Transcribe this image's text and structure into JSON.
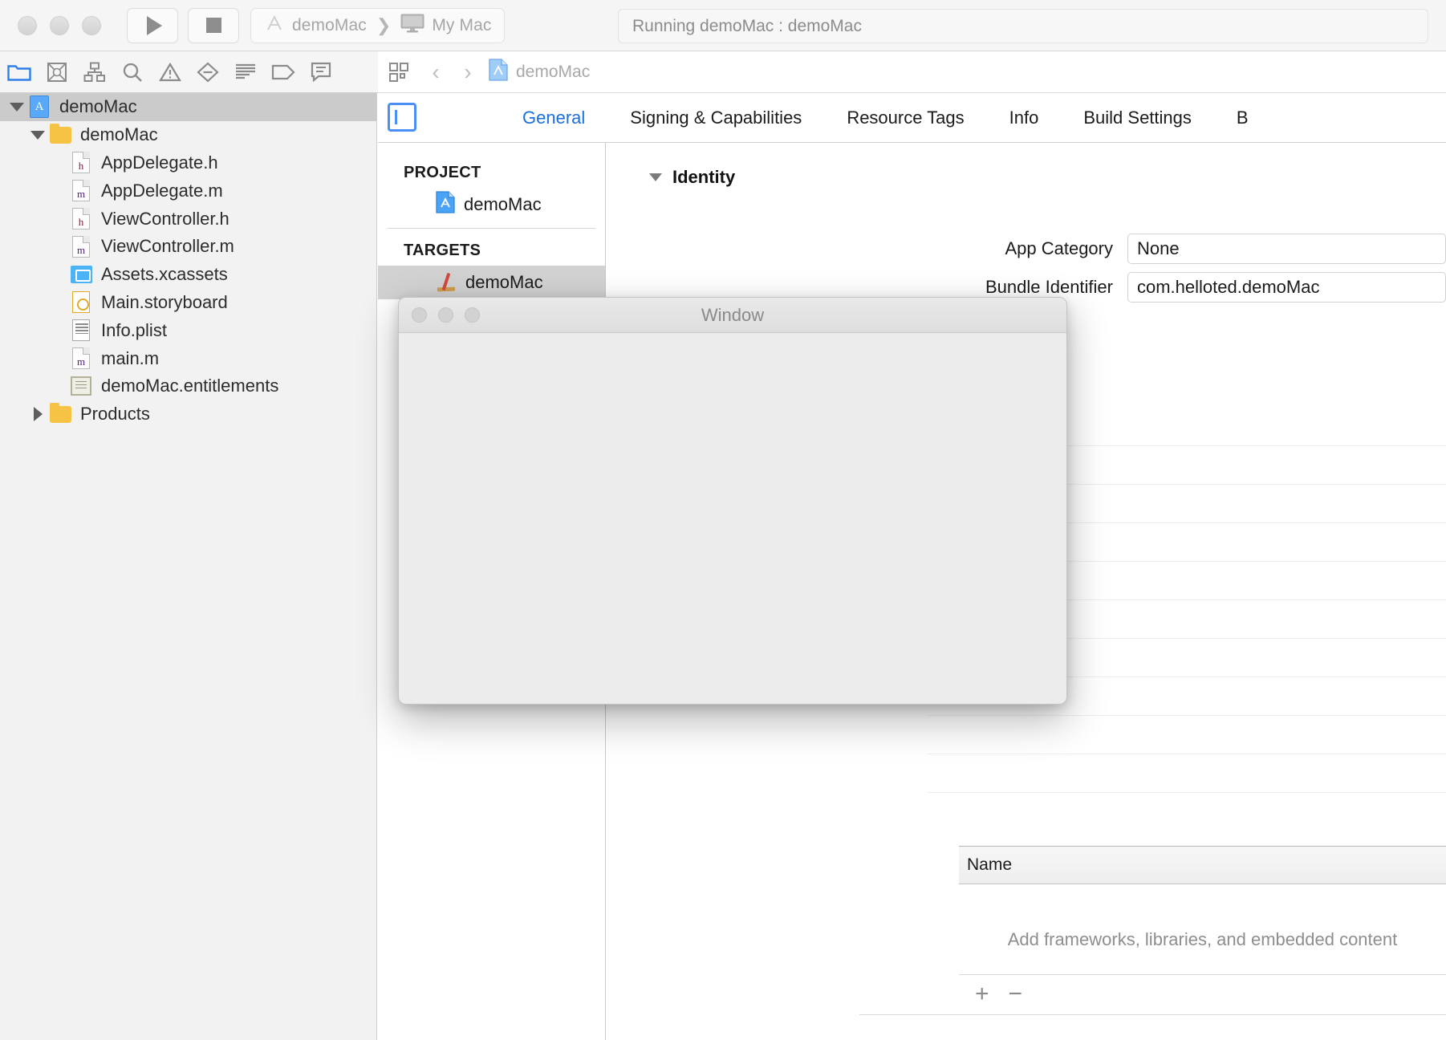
{
  "window_title": "demoMac",
  "titlebar": {
    "traffic_lights": [
      "close-button",
      "minimize-button",
      "zoom-button"
    ],
    "run_button_label": "run-button",
    "stop_button_label": "stop-button",
    "scheme": "demoMac",
    "destination": "My Mac",
    "scheme_separator": "❯",
    "status": "Running demoMac : demoMac"
  },
  "navigator_toolbar": {
    "items": [
      {
        "name": "project-navigator",
        "icon": "folder-icon",
        "active": true
      },
      {
        "name": "source-control-navigator",
        "icon": "source-control-icon",
        "active": false
      },
      {
        "name": "symbol-navigator",
        "icon": "hierarchy-icon",
        "active": false
      },
      {
        "name": "find-navigator",
        "icon": "search-icon",
        "active": false
      },
      {
        "name": "issue-navigator",
        "icon": "warning-triangle-icon",
        "active": false
      },
      {
        "name": "test-navigator",
        "icon": "minus-diamond-icon",
        "active": false
      },
      {
        "name": "debug-navigator",
        "icon": "list-lines-icon",
        "active": false
      },
      {
        "name": "breakpoint-navigator",
        "icon": "tag-icon",
        "active": false
      },
      {
        "name": "report-navigator",
        "icon": "speech-bubble-icon",
        "active": false
      }
    ]
  },
  "sidebar": {
    "tree": [
      {
        "label": "demoMac",
        "indent": 0,
        "disclosure": "down",
        "icon": "xcodeproj-icon",
        "selected": true
      },
      {
        "label": "demoMac",
        "indent": 1,
        "disclosure": "down",
        "icon": "folder-icon",
        "selected": false
      },
      {
        "label": "AppDelegate.h",
        "indent": 2,
        "disclosure": "none",
        "icon": "header-file-icon",
        "selected": false
      },
      {
        "label": "AppDelegate.m",
        "indent": 2,
        "disclosure": "none",
        "icon": "objc-file-icon",
        "selected": false
      },
      {
        "label": "ViewController.h",
        "indent": 2,
        "disclosure": "none",
        "icon": "header-file-icon",
        "selected": false
      },
      {
        "label": "ViewController.m",
        "indent": 2,
        "disclosure": "none",
        "icon": "objc-file-icon",
        "selected": false
      },
      {
        "label": "Assets.xcassets",
        "indent": 2,
        "disclosure": "none",
        "icon": "xcassets-icon",
        "selected": false
      },
      {
        "label": "Main.storyboard",
        "indent": 2,
        "disclosure": "none",
        "icon": "storyboard-icon",
        "selected": false
      },
      {
        "label": "Info.plist",
        "indent": 2,
        "disclosure": "none",
        "icon": "plist-icon",
        "selected": false
      },
      {
        "label": "main.m",
        "indent": 2,
        "disclosure": "none",
        "icon": "objc-file-icon",
        "selected": false
      },
      {
        "label": "demoMac.entitlements",
        "indent": 2,
        "disclosure": "none",
        "icon": "entitlements-icon",
        "selected": false
      },
      {
        "label": "Products",
        "indent": 1,
        "disclosure": "right",
        "icon": "folder-icon",
        "selected": false
      }
    ]
  },
  "editor": {
    "jumpbar": {
      "related_items_icon": "related-items-icon",
      "back_arrow": "‹",
      "forward_arrow": "›",
      "breadcrumb": "demoMac"
    },
    "tabs": [
      {
        "label": "General",
        "selected": true
      },
      {
        "label": "Signing & Capabilities",
        "selected": false
      },
      {
        "label": "Resource Tags",
        "selected": false
      },
      {
        "label": "Info",
        "selected": false
      },
      {
        "label": "Build Settings",
        "selected": false
      },
      {
        "label": "B",
        "selected": false
      }
    ],
    "project_list": {
      "project_header": "PROJECT",
      "project_items": [
        {
          "label": "demoMac",
          "icon": "xcodeproj-icon",
          "selected": false
        }
      ],
      "targets_header": "TARGETS",
      "target_items": [
        {
          "label": "demoMac",
          "icon": "target-hammer-icon",
          "selected": true
        }
      ]
    },
    "identity": {
      "section_title": "Identity",
      "fields": [
        {
          "label": "App Category",
          "value": "None"
        },
        {
          "label": "Bundle Identifier",
          "value": "com.helloted.demoMac"
        }
      ]
    },
    "frameworks": {
      "column_header": "Name",
      "empty_text": "Add frameworks, libraries, and embedded content",
      "add_button": "+",
      "remove_button": "−"
    }
  },
  "app_window": {
    "title": "Window",
    "traffic_lights": [
      "close-button",
      "minimize-button",
      "zoom-button"
    ]
  },
  "colors": {
    "accent_blue": "#1a6fe0",
    "nav_active": "#2f7fe8",
    "selected_row": "#cbcbcb",
    "sidebar_bg": "#f2f2f2",
    "titlebar_bg": "#f5f5f5"
  }
}
